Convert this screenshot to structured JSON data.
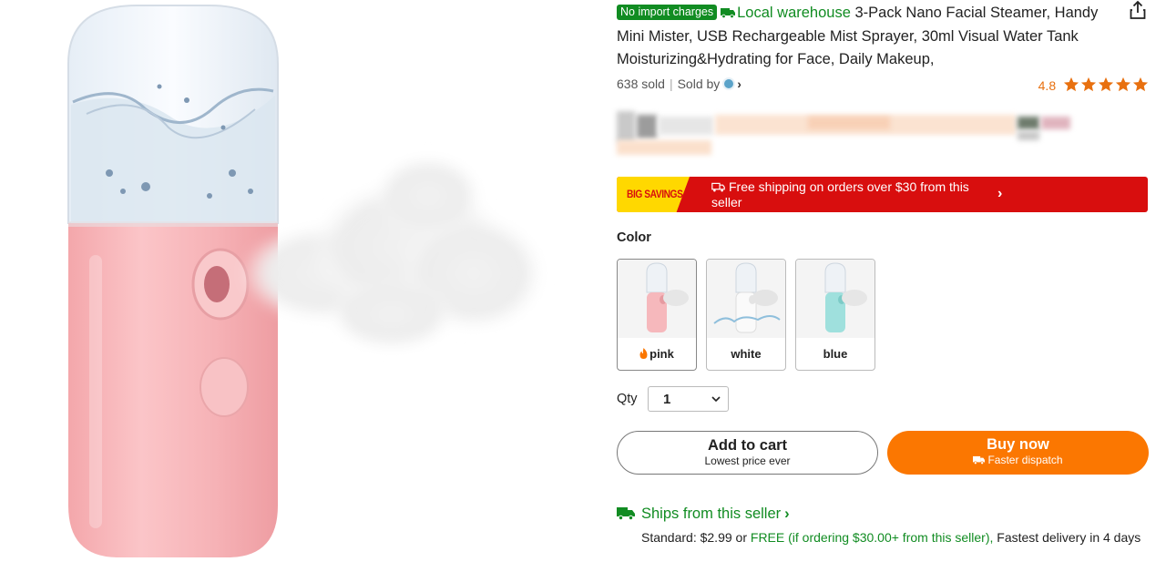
{
  "product": {
    "badge_no_import": "No import charges",
    "local_warehouse": "Local warehouse",
    "title": "3-Pack Nano Facial Steamer, Handy Mini Mister, USB Rechargeable Mist Sprayer, 30ml Visual Water Tank Moisturizing&Hydrating for Face, Daily Makeup,",
    "sold": "638 sold",
    "sold_by_label": "Sold by",
    "rating": "4.8",
    "stars": 5
  },
  "promo": {
    "badge": "BIG SAVINGS",
    "text": "Free shipping on orders over $30 from this seller"
  },
  "color": {
    "label": "Color",
    "options": [
      {
        "name": "pink",
        "swatch": "#f6b8bc",
        "selected": true,
        "hot": true
      },
      {
        "name": "white",
        "swatch": "#f2f2f2",
        "selected": false,
        "hot": false
      },
      {
        "name": "blue",
        "swatch": "#9fe0dd",
        "selected": false,
        "hot": false
      }
    ]
  },
  "qty": {
    "label": "Qty",
    "value": "1"
  },
  "buttons": {
    "add_to_cart": "Add to cart",
    "add_to_cart_sub": "Lowest price ever",
    "buy_now": "Buy now",
    "buy_now_sub": "Faster dispatch"
  },
  "shipping": {
    "ships_from": "Ships from this seller",
    "standard_label": "Standard:",
    "standard_price": "$2.99",
    "or": "or",
    "free_text": "FREE (if ordering $30.00+ from this seller),",
    "fastest": "Fastest delivery in 4 days"
  },
  "colors": {
    "green": "#118c22",
    "orange": "#fb7701",
    "promo_red": "#d80e0e",
    "promo_yellow": "#ffd800",
    "rating_orange": "#e8700f",
    "product_pink": "#f6b8bc"
  },
  "icons": [
    "share-icon",
    "truck-icon",
    "star-icon",
    "chevron-right-icon",
    "chevron-down-icon",
    "flame-icon"
  ]
}
